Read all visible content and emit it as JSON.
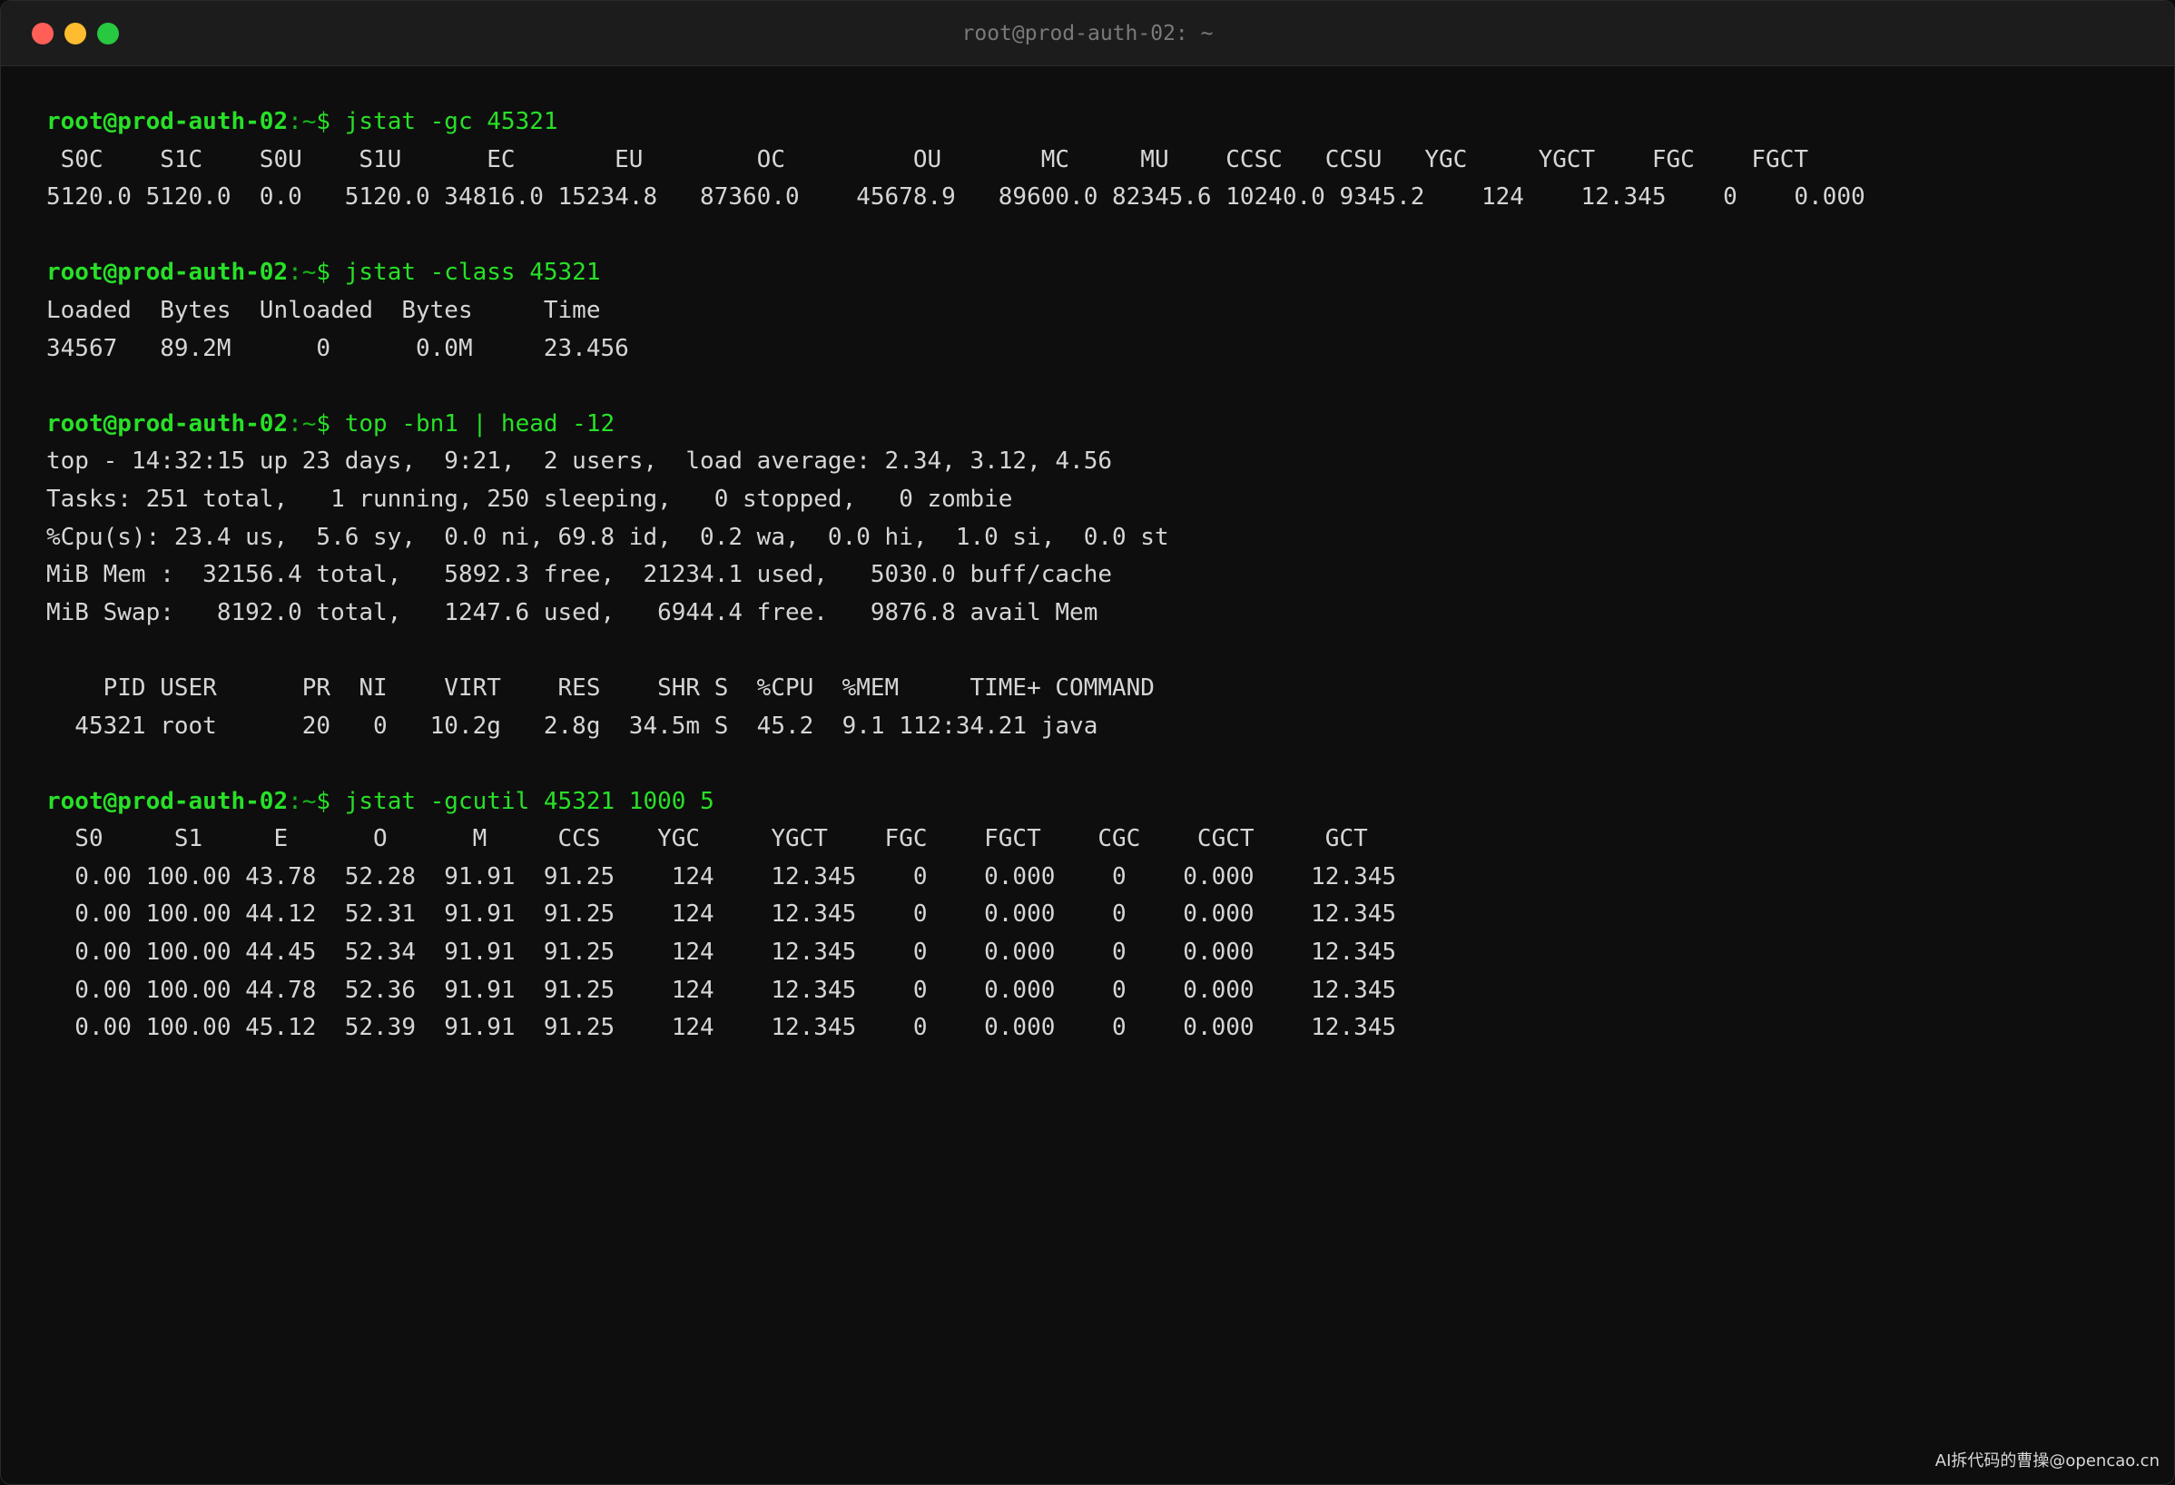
{
  "window": {
    "title": "root@prod-auth-02: ~"
  },
  "prompt": {
    "user_host": "root@prod-auth-02",
    "path": ":~",
    "symbol": "$"
  },
  "blocks": [
    {
      "command": "jstat -gc 45321",
      "output": [
        " S0C    S1C    S0U    S1U      EC       EU        OC         OU       MC     MU    CCSC   CCSU   YGC     YGCT    FGC    FGCT",
        "5120.0 5120.0  0.0   5120.0 34816.0 15234.8   87360.0    45678.9   89600.0 82345.6 10240.0 9345.2    124    12.345    0    0.000"
      ]
    },
    {
      "command": "jstat -class 45321",
      "output": [
        "Loaded  Bytes  Unloaded  Bytes     Time",
        "34567   89.2M      0      0.0M     23.456"
      ]
    },
    {
      "command": "top -bn1 | head -12",
      "output": [
        "top - 14:32:15 up 23 days,  9:21,  2 users,  load average: 2.34, 3.12, 4.56",
        "Tasks: 251 total,   1 running, 250 sleeping,   0 stopped,   0 zombie",
        "%Cpu(s): 23.4 us,  5.6 sy,  0.0 ni, 69.8 id,  0.2 wa,  0.0 hi,  1.0 si,  0.0 st",
        "MiB Mem :  32156.4 total,   5892.3 free,  21234.1 used,   5030.0 buff/cache",
        "MiB Swap:   8192.0 total,   1247.6 used,   6944.4 free.   9876.8 avail Mem",
        "",
        "    PID USER      PR  NI    VIRT    RES    SHR S  %CPU  %MEM     TIME+ COMMAND",
        "  45321 root      20   0   10.2g   2.8g  34.5m S  45.2  9.1 112:34.21 java"
      ]
    },
    {
      "command": "jstat -gcutil 45321 1000 5",
      "output": [
        "  S0     S1     E      O      M     CCS    YGC     YGCT    FGC    FGCT    CGC    CGCT     GCT",
        "  0.00 100.00 43.78  52.28  91.91  91.25    124    12.345    0    0.000    0    0.000    12.345",
        "  0.00 100.00 44.12  52.31  91.91  91.25    124    12.345    0    0.000    0    0.000    12.345",
        "  0.00 100.00 44.45  52.34  91.91  91.25    124    12.345    0    0.000    0    0.000    12.345",
        "  0.00 100.00 44.78  52.36  91.91  91.25    124    12.345    0    0.000    0    0.000    12.345",
        "  0.00 100.00 45.12  52.39  91.91  91.25    124    12.345    0    0.000    0    0.000    12.345"
      ]
    }
  ],
  "watermark": "AI拆代码的曹操@opencao.cn",
  "colors": {
    "background": "#0e0e0e",
    "prompt_green": "#28e028",
    "text": "#d6d6d6"
  }
}
